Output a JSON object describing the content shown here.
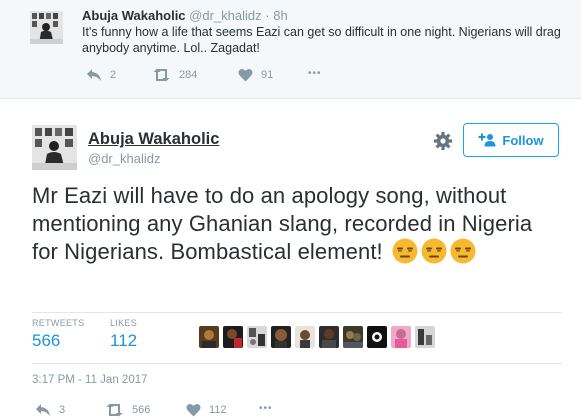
{
  "previous_tweet": {
    "name": "Abuja Wakaholic",
    "handle": "@dr_khalidz",
    "separator": "·",
    "time": "8h",
    "text": "It's funny how a life that seems Eazi can get so difficult in one night. Nigerians will drag anybody anytime. Lol.. Zagadat!",
    "reply_count": "2",
    "retweet_count": "284",
    "like_count": "91",
    "more_label": "•••"
  },
  "tweet": {
    "name": "Abuja Wakaholic",
    "handle": "@dr_khalidz",
    "follow_label": "Follow",
    "text": "Mr Eazi will have to do an apology song, without mentioning any Ghanian slang, recorded in Nigeria for Nigerians. Bombastical element!",
    "emoji": [
      "expressionless-face",
      "expressionless-face",
      "expressionless-face"
    ],
    "retweets_label": "RETWEETS",
    "retweets": "566",
    "likes_label": "LIKES",
    "likes": "112",
    "liker_avatar_count": 10,
    "timestamp": "3:17 PM - 11 Jan 2017",
    "reply_count": "3",
    "retweet_count": "566",
    "like_count": "112",
    "more_label": "•••"
  },
  "colors": {
    "accent": "#1da1f2",
    "link_blue": "#1b95e0",
    "muted": "#8899a6",
    "text": "#292f33",
    "prev_bg": "#f5f8fa",
    "emoji": "#f7b930"
  }
}
